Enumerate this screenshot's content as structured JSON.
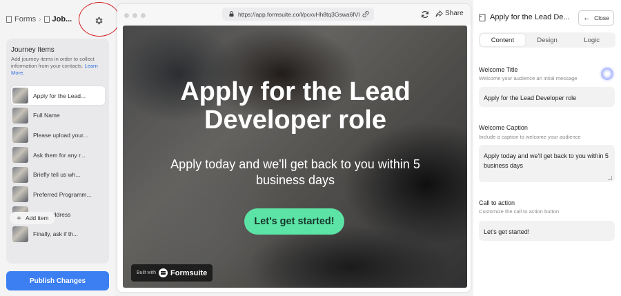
{
  "breadcrumb": {
    "root": "Forms",
    "current": "Job..."
  },
  "sidebar": {
    "section_title": "Journey Items",
    "description": "Add journey items in order to collect information from your contacts.",
    "learn_more": "Learn More.",
    "items": [
      {
        "label": "Apply for the Lead..."
      },
      {
        "label": "Full Name"
      },
      {
        "label": "Please upload your..."
      },
      {
        "label": "Ask them for any r..."
      },
      {
        "label": "Briefly tell us wh..."
      },
      {
        "label": "Preferred Programm..."
      },
      {
        "label": "Email Address"
      },
      {
        "label": "Finally, ask if th..."
      }
    ],
    "add_item": "Add item",
    "publish": "Publish Changes"
  },
  "browser": {
    "url": "https://app.formsuite.co/l/pcxvHh8tq3Gswa6fVl",
    "share": "Share"
  },
  "preview": {
    "title": "Apply for the Lead Developer role",
    "caption": "Apply today and we'll get back to you within 5 business days",
    "cta": "Let's get started!",
    "built_with": "Built with",
    "brand": "Formsuite"
  },
  "panel": {
    "header": "Apply for the Lead De...",
    "close": "Close",
    "tabs": [
      "Content",
      "Design",
      "Logic"
    ],
    "welcome_title_label": "Welcome Title",
    "welcome_title_hint": "Welcome your audience an intial message",
    "welcome_title_value": "Apply for the Lead Developer role",
    "welcome_caption_label": "Welcome Caption",
    "welcome_caption_hint": "Include a caption to welcome your audience",
    "welcome_caption_value": "Apply today and we'll get back to you within 5 business days",
    "cta_label": "Call to action",
    "cta_hint": "Customize the call to action button",
    "cta_value": "Let's get started!"
  },
  "colors": {
    "accent": "#3b7ff2",
    "cta_button": "#5ce3a6",
    "highlight_ring": "#d42222"
  }
}
